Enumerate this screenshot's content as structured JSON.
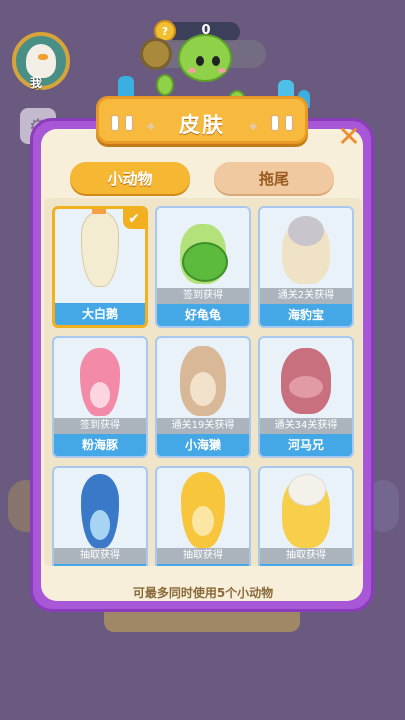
{
  "hud": {
    "me_label": "我",
    "coin_value": "0",
    "coin_symbol": "?"
  },
  "dialog": {
    "title": "皮肤",
    "close_symbol": "✕",
    "tabs": [
      {
        "label": "小动物",
        "active": true
      },
      {
        "label": "拖尾",
        "active": false
      }
    ],
    "items": [
      {
        "name": "大白鹅",
        "unlock": "",
        "selected": true,
        "icon": "goose"
      },
      {
        "name": "好龟龟",
        "unlock": "签到获得",
        "selected": false,
        "icon": "turtle"
      },
      {
        "name": "海豹宝",
        "unlock": "通关2关获得",
        "selected": false,
        "icon": "seal"
      },
      {
        "name": "粉海豚",
        "unlock": "签到获得",
        "selected": false,
        "icon": "dolphin"
      },
      {
        "name": "小海獭",
        "unlock": "通关19关获得",
        "selected": false,
        "icon": "otter"
      },
      {
        "name": "河马兄",
        "unlock": "通关34关获得",
        "selected": false,
        "icon": "hippo"
      },
      {
        "name": "",
        "unlock": "抽取获得",
        "selected": false,
        "icon": "whale-shark"
      },
      {
        "name": "",
        "unlock": "抽取获得",
        "selected": false,
        "icon": "pufferfish"
      },
      {
        "name": "",
        "unlock": "抽取获得",
        "selected": false,
        "icon": "seal-mermaid"
      }
    ],
    "footer": "可最多同时使用5个小动物",
    "check_symbol": "✔"
  },
  "colors": {
    "frame": "#a857d6",
    "panel": "#f7efd9",
    "accent": "#f6b732",
    "name_bar": "#44a8e6"
  }
}
